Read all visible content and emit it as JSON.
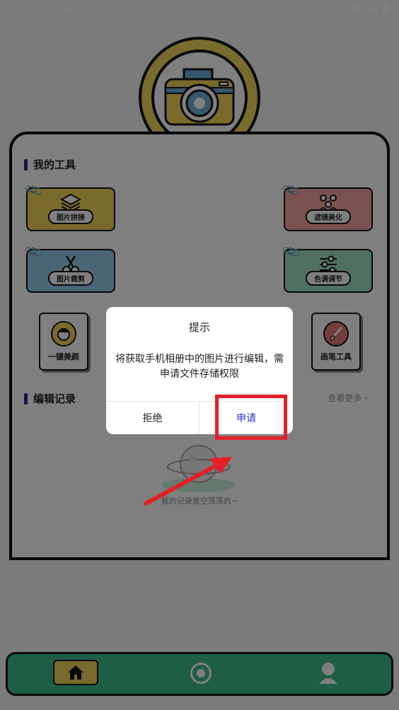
{
  "status_bar": {
    "time": "5:18"
  },
  "tools_section": {
    "title": "我的工具"
  },
  "tools": {
    "collage": "图片拼接",
    "filter": "滤镜美化",
    "crop": "图片裁剪",
    "color": "色调调节",
    "beauty": "一键美颜",
    "brush": "画笔工具"
  },
  "history_section": {
    "title": "编辑记录",
    "view_more": "查看更多 ›"
  },
  "empty_state": {
    "text": "我的记录是空荡荡的~"
  },
  "dialog": {
    "title": "提示",
    "message": "将获取手机相册中的图片进行编辑，需申请文件存储权限",
    "reject": "拒绝",
    "apply": "申请"
  },
  "colors": {
    "accent_yellow": "#f4d658",
    "nav_green": "#3bbd8a",
    "apply_blue": "#2234c8",
    "annotation_red": "#e51f27"
  },
  "icons": [
    "camera-icon",
    "layers-icon",
    "molecule-icon",
    "scissors-icon",
    "sliders-icon",
    "face-icon",
    "brush-icon",
    "planet-icon",
    "home-icon",
    "discover-icon",
    "profile-icon"
  ]
}
